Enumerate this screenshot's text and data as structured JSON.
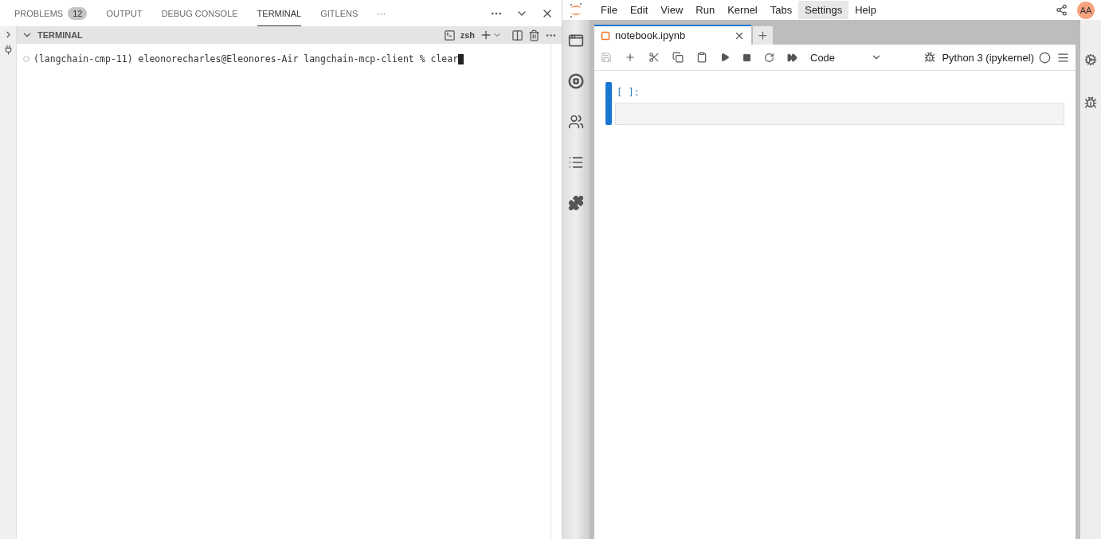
{
  "panel": {
    "tabs": [
      {
        "label": "PROBLEMS",
        "badge": "12",
        "selected": false
      },
      {
        "label": "OUTPUT",
        "selected": false
      },
      {
        "label": "DEBUG CONSOLE",
        "selected": false
      },
      {
        "label": "TERMINAL",
        "selected": true
      },
      {
        "label": "GITLENS",
        "selected": false
      }
    ],
    "overflow": "···"
  },
  "terminal": {
    "title": "TERMINAL",
    "expanded": true,
    "shell": "zsh",
    "lines": [
      {
        "text": "(langchain-cmp-11) eleonorecharles@Eleonores-Air langchain-mcp-client % clear"
      }
    ]
  },
  "jupyter": {
    "menu": [
      {
        "label": "File",
        "selected": false
      },
      {
        "label": "Edit",
        "selected": false
      },
      {
        "label": "View",
        "selected": false
      },
      {
        "label": "Run",
        "selected": false
      },
      {
        "label": "Kernel",
        "selected": false
      },
      {
        "label": "Tabs",
        "selected": false
      },
      {
        "label": "Settings",
        "selected": true
      },
      {
        "label": "Help",
        "selected": false
      }
    ],
    "avatar": "AA",
    "documents": [
      {
        "label": "notebook.ipynb",
        "selected": true
      }
    ],
    "cell_type": "Code",
    "kernel": "Python 3 (ipykernel)",
    "cells": [
      {
        "prompt": "[ ]:",
        "active": true
      }
    ]
  }
}
